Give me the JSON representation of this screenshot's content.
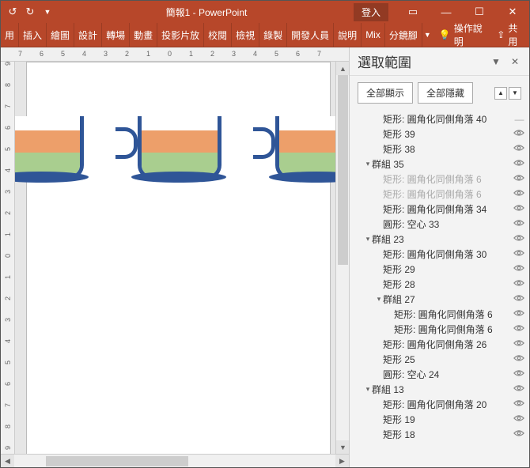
{
  "titlebar": {
    "title": "簡報1 - PowerPoint",
    "login": "登入"
  },
  "ribbon": {
    "tabs": [
      "用",
      "插入",
      "繪圖",
      "設計",
      "轉場",
      "動畫",
      "投影片放",
      "校閱",
      "檢視",
      "錄製",
      "開發人員",
      "說明",
      "Mix",
      "分鏡腳"
    ],
    "help_label": "操作說明",
    "share_label": "共用"
  },
  "ruler": {
    "top": [
      "7",
      "6",
      "5",
      "4",
      "3",
      "2",
      "1",
      "0",
      "1",
      "2",
      "3",
      "4",
      "5",
      "6",
      "7"
    ],
    "left": [
      "9",
      "8",
      "7",
      "6",
      "5",
      "4",
      "3",
      "2",
      "1",
      "0",
      "1",
      "2",
      "3",
      "4",
      "5",
      "6",
      "7",
      "8",
      "9"
    ]
  },
  "chart_data": {
    "type": "bar",
    "note": "three cup graphics with two stacked color layers",
    "series": [
      {
        "name": "orange",
        "values": [
          35,
          35,
          35
        ]
      },
      {
        "name": "green",
        "values": [
          40,
          40,
          40
        ]
      }
    ],
    "categories": [
      "cup1",
      "cup2",
      "cup3"
    ]
  },
  "panel": {
    "title": "選取範圍",
    "show_all": "全部顯示",
    "hide_all": "全部隱藏",
    "items": [
      {
        "d": 1,
        "a": "",
        "t": "矩形: 圓角化同側角落 40",
        "e": "line"
      },
      {
        "d": 1,
        "a": "",
        "t": "矩形 39",
        "e": "eye"
      },
      {
        "d": 1,
        "a": "",
        "t": "矩形 38",
        "e": "eye"
      },
      {
        "d": 0,
        "a": "▾",
        "t": "群組 35",
        "e": "eye"
      },
      {
        "d": 1,
        "a": "",
        "t": "矩形: 圓角化同側角落 6",
        "e": "eye",
        "dim": true
      },
      {
        "d": 1,
        "a": "",
        "t": "矩形: 圓角化同側角落 6",
        "e": "eye",
        "dim": true
      },
      {
        "d": 1,
        "a": "",
        "t": "矩形: 圓角化同側角落 34",
        "e": "eye"
      },
      {
        "d": 1,
        "a": "",
        "t": "圓形: 空心 33",
        "e": "eye"
      },
      {
        "d": 0,
        "a": "▾",
        "t": "群組 23",
        "e": "eye"
      },
      {
        "d": 1,
        "a": "",
        "t": "矩形: 圓角化同側角落 30",
        "e": "eye"
      },
      {
        "d": 1,
        "a": "",
        "t": "矩形 29",
        "e": "eye"
      },
      {
        "d": 1,
        "a": "",
        "t": "矩形 28",
        "e": "eye"
      },
      {
        "d": 1,
        "a": "▾",
        "t": "群組 27",
        "e": "eye"
      },
      {
        "d": 2,
        "a": "",
        "t": "矩形: 圓角化同側角落 6",
        "e": "eye"
      },
      {
        "d": 2,
        "a": "",
        "t": "矩形: 圓角化同側角落 6",
        "e": "eye"
      },
      {
        "d": 1,
        "a": "",
        "t": "矩形: 圓角化同側角落 26",
        "e": "eye"
      },
      {
        "d": 1,
        "a": "",
        "t": "矩形 25",
        "e": "eye"
      },
      {
        "d": 1,
        "a": "",
        "t": "圓形: 空心 24",
        "e": "eye"
      },
      {
        "d": 0,
        "a": "▾",
        "t": "群組 13",
        "e": "eye"
      },
      {
        "d": 1,
        "a": "",
        "t": "矩形: 圓角化同側角落 20",
        "e": "eye"
      },
      {
        "d": 1,
        "a": "",
        "t": "矩形 19",
        "e": "eye"
      },
      {
        "d": 1,
        "a": "",
        "t": "矩形 18",
        "e": "eye"
      }
    ]
  }
}
